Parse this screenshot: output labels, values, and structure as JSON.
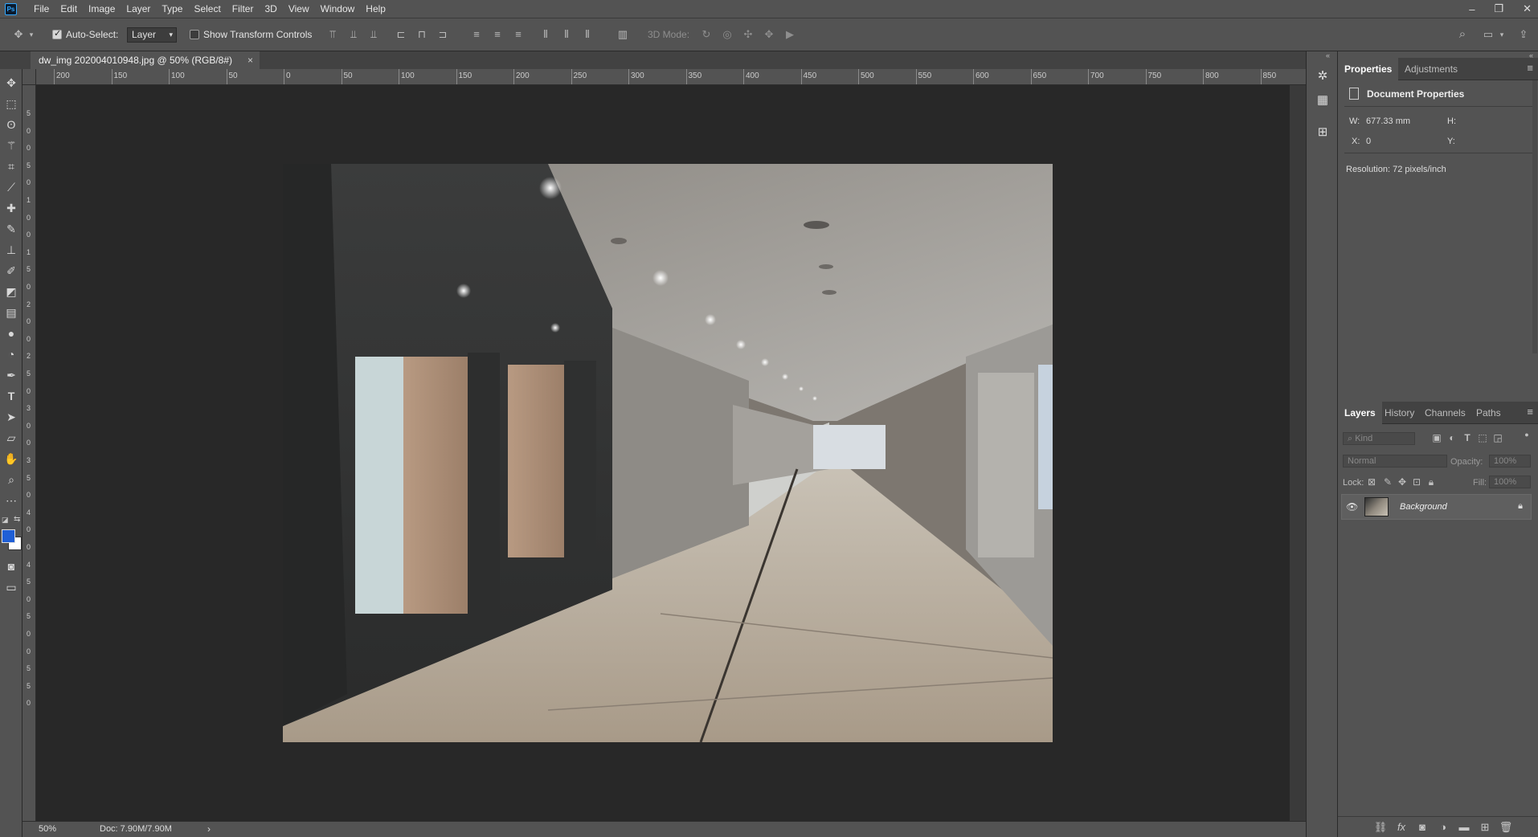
{
  "app": {
    "logo_text": "Ps"
  },
  "menu": [
    "File",
    "Edit",
    "Image",
    "Layer",
    "Type",
    "Select",
    "Filter",
    "3D",
    "View",
    "Window",
    "Help"
  ],
  "window_controls": [
    "–",
    "❐",
    "✕"
  ],
  "options_bar": {
    "auto_select_label": "Auto-Select:",
    "auto_select_checked": true,
    "auto_select_target": "Layer",
    "show_transform_label": "Show Transform Controls",
    "show_transform_checked": false,
    "mode_3d_label": "3D Mode:"
  },
  "document_tab": {
    "title": "dw_img 202004010948.jpg @ 50% (RGB/8#)",
    "close": "×"
  },
  "rulers": {
    "horizontal_labels": [
      "200",
      "150",
      "100",
      "50",
      "0",
      "50",
      "100",
      "150",
      "200",
      "250",
      "300",
      "350",
      "400",
      "450",
      "500",
      "550",
      "600",
      "650",
      "700",
      "750",
      "800",
      "850"
    ],
    "vertical_labels": [
      "5",
      "0",
      "0",
      "5",
      "0",
      "1",
      "0",
      "0",
      "1",
      "5",
      "0",
      "2",
      "0",
      "0",
      "2",
      "5",
      "0",
      "3",
      "0",
      "0",
      "3",
      "5",
      "0",
      "4",
      "0",
      "0",
      "4",
      "5",
      "0",
      "5",
      "0",
      "0",
      "5",
      "5",
      "0"
    ]
  },
  "status": {
    "zoom": "50%",
    "doc_size": "Doc: 7.90M/7.90M",
    "arrow": "›"
  },
  "properties_panel": {
    "tabs": [
      "Properties",
      "Adjustments"
    ],
    "active_tab": "Properties",
    "section_title": "Document Properties",
    "w_label": "W:",
    "w_value": "677.33 mm",
    "h_label": "H:",
    "x_label": "X:",
    "x_value": "0",
    "y_label": "Y:",
    "resolution": "Resolution: 72 pixels/inch"
  },
  "layers_panel": {
    "tabs": [
      "Layers",
      "History",
      "Channels",
      "Paths"
    ],
    "active_tab": "Layers",
    "filter_placeholder": "Kind",
    "blend_mode": "Normal",
    "opacity_label": "Opacity:",
    "opacity_value": "100%",
    "lock_label": "Lock:",
    "fill_label": "Fill:",
    "fill_value": "100%",
    "layers": [
      {
        "name": "Background",
        "visible": true,
        "locked": true
      }
    ]
  },
  "colors": {
    "foreground": "#1f5fd6",
    "background": "#ffffff",
    "accent": "#31a8ff"
  },
  "icons": {
    "tools": [
      "move-icon",
      "marquee-icon",
      "lasso-icon",
      "magic-wand-icon",
      "crop-icon",
      "eyedropper-icon",
      "healing-brush-icon",
      "brush-icon",
      "clone-stamp-icon",
      "history-brush-icon",
      "eraser-icon",
      "gradient-icon",
      "blur-icon",
      "dodge-icon",
      "pen-icon",
      "type-icon",
      "path-select-icon",
      "shape-icon",
      "hand-icon",
      "zoom-icon",
      "more-tools-icon"
    ]
  }
}
